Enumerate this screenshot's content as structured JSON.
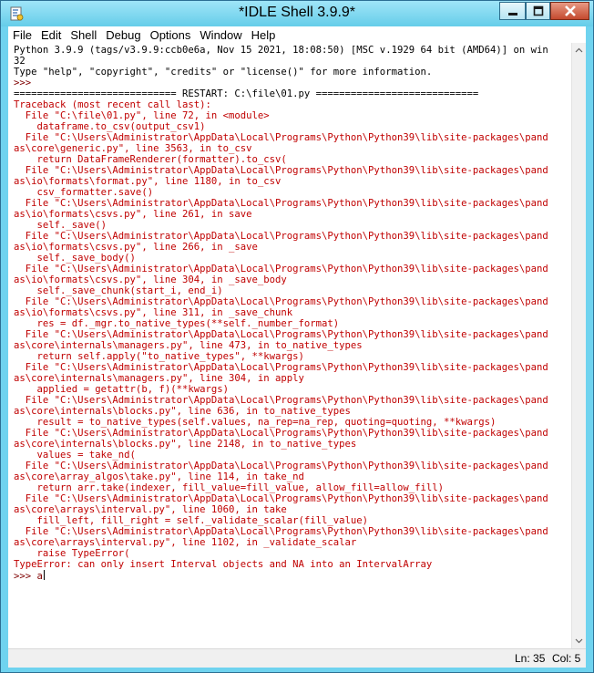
{
  "window": {
    "title": "*IDLE Shell 3.9.9*",
    "icon": "idle-app-icon",
    "controls": {
      "minimize": "minimize-icon",
      "maximize": "maximize-icon",
      "close": "close-icon"
    }
  },
  "menubar": {
    "items": [
      "File",
      "Edit",
      "Shell",
      "Debug",
      "Options",
      "Window",
      "Help"
    ]
  },
  "shell": {
    "lines": [
      {
        "text": "Python 3.9.9 (tags/v3.9.9:ccb0e6a, Nov 15 2021, 18:08:50) [MSC v.1929 64 bit (AMD64)] on win",
        "kind": "output"
      },
      {
        "text": "32",
        "kind": "output"
      },
      {
        "text": "Type \"help\", \"copyright\", \"credits\" or \"license()\" for more information.",
        "kind": "output"
      },
      {
        "text": ">>>",
        "kind": "prompt"
      },
      {
        "text": "============================ RESTART: C:\\file\\01.py ============================",
        "kind": "output"
      },
      {
        "text": "Traceback (most recent call last):",
        "kind": "err"
      },
      {
        "text": "  File \"C:\\file\\01.py\", line 72, in <module>",
        "kind": "err"
      },
      {
        "text": "    dataframe.to_csv(output_csv1)",
        "kind": "err"
      },
      {
        "text": "  File \"C:\\Users\\Administrator\\AppData\\Local\\Programs\\Python\\Python39\\lib\\site-packages\\pand",
        "kind": "err"
      },
      {
        "text": "as\\core\\generic.py\", line 3563, in to_csv",
        "kind": "err"
      },
      {
        "text": "    return DataFrameRenderer(formatter).to_csv(",
        "kind": "err"
      },
      {
        "text": "  File \"C:\\Users\\Administrator\\AppData\\Local\\Programs\\Python\\Python39\\lib\\site-packages\\pand",
        "kind": "err"
      },
      {
        "text": "as\\io\\formats\\format.py\", line 1180, in to_csv",
        "kind": "err"
      },
      {
        "text": "    csv_formatter.save()",
        "kind": "err"
      },
      {
        "text": "  File \"C:\\Users\\Administrator\\AppData\\Local\\Programs\\Python\\Python39\\lib\\site-packages\\pand",
        "kind": "err"
      },
      {
        "text": "as\\io\\formats\\csvs.py\", line 261, in save",
        "kind": "err"
      },
      {
        "text": "    self._save()",
        "kind": "err"
      },
      {
        "text": "  File \"C:\\Users\\Administrator\\AppData\\Local\\Programs\\Python\\Python39\\lib\\site-packages\\pand",
        "kind": "err"
      },
      {
        "text": "as\\io\\formats\\csvs.py\", line 266, in _save",
        "kind": "err"
      },
      {
        "text": "    self._save_body()",
        "kind": "err"
      },
      {
        "text": "  File \"C:\\Users\\Administrator\\AppData\\Local\\Programs\\Python\\Python39\\lib\\site-packages\\pand",
        "kind": "err"
      },
      {
        "text": "as\\io\\formats\\csvs.py\", line 304, in _save_body",
        "kind": "err"
      },
      {
        "text": "    self._save_chunk(start_i, end_i)",
        "kind": "err"
      },
      {
        "text": "  File \"C:\\Users\\Administrator\\AppData\\Local\\Programs\\Python\\Python39\\lib\\site-packages\\pand",
        "kind": "err"
      },
      {
        "text": "as\\io\\formats\\csvs.py\", line 311, in _save_chunk",
        "kind": "err"
      },
      {
        "text": "    res = df._mgr.to_native_types(**self._number_format)",
        "kind": "err"
      },
      {
        "text": "  File \"C:\\Users\\Administrator\\AppData\\Local\\Programs\\Python\\Python39\\lib\\site-packages\\pand",
        "kind": "err"
      },
      {
        "text": "as\\core\\internals\\managers.py\", line 473, in to_native_types",
        "kind": "err"
      },
      {
        "text": "    return self.apply(\"to_native_types\", **kwargs)",
        "kind": "err"
      },
      {
        "text": "  File \"C:\\Users\\Administrator\\AppData\\Local\\Programs\\Python\\Python39\\lib\\site-packages\\pand",
        "kind": "err"
      },
      {
        "text": "as\\core\\internals\\managers.py\", line 304, in apply",
        "kind": "err"
      },
      {
        "text": "    applied = getattr(b, f)(**kwargs)",
        "kind": "err"
      },
      {
        "text": "  File \"C:\\Users\\Administrator\\AppData\\Local\\Programs\\Python\\Python39\\lib\\site-packages\\pand",
        "kind": "err"
      },
      {
        "text": "as\\core\\internals\\blocks.py\", line 636, in to_native_types",
        "kind": "err"
      },
      {
        "text": "    result = to_native_types(self.values, na_rep=na_rep, quoting=quoting, **kwargs)",
        "kind": "err"
      },
      {
        "text": "  File \"C:\\Users\\Administrator\\AppData\\Local\\Programs\\Python\\Python39\\lib\\site-packages\\pand",
        "kind": "err"
      },
      {
        "text": "as\\core\\internals\\blocks.py\", line 2148, in to_native_types",
        "kind": "err"
      },
      {
        "text": "    values = take_nd(",
        "kind": "err"
      },
      {
        "text": "  File \"C:\\Users\\Administrator\\AppData\\Local\\Programs\\Python\\Python39\\lib\\site-packages\\pand",
        "kind": "err"
      },
      {
        "text": "as\\core\\array_algos\\take.py\", line 114, in take_nd",
        "kind": "err"
      },
      {
        "text": "    return arr.take(indexer, fill_value=fill_value, allow_fill=allow_fill)",
        "kind": "err"
      },
      {
        "text": "  File \"C:\\Users\\Administrator\\AppData\\Local\\Programs\\Python\\Python39\\lib\\site-packages\\pand",
        "kind": "err"
      },
      {
        "text": "as\\core\\arrays\\interval.py\", line 1060, in take",
        "kind": "err"
      },
      {
        "text": "    fill_left, fill_right = self._validate_scalar(fill_value)",
        "kind": "err"
      },
      {
        "text": "  File \"C:\\Users\\Administrator\\AppData\\Local\\Programs\\Python\\Python39\\lib\\site-packages\\pand",
        "kind": "err"
      },
      {
        "text": "as\\core\\arrays\\interval.py\", line 1102, in _validate_scalar",
        "kind": "err"
      },
      {
        "text": "    raise TypeError(",
        "kind": "err"
      },
      {
        "text": "TypeError: can only insert Interval objects and NA into an IntervalArray",
        "kind": "err"
      },
      {
        "text": ">>> a",
        "kind": "prompt-input"
      }
    ]
  },
  "statusbar": {
    "line": "Ln: 35",
    "col": "Col: 5"
  },
  "colors": {
    "titlebar": "#6fd3ef",
    "error_text": "#c00000",
    "prompt_text": "#7f0000",
    "close_button": "#c44a2f"
  }
}
